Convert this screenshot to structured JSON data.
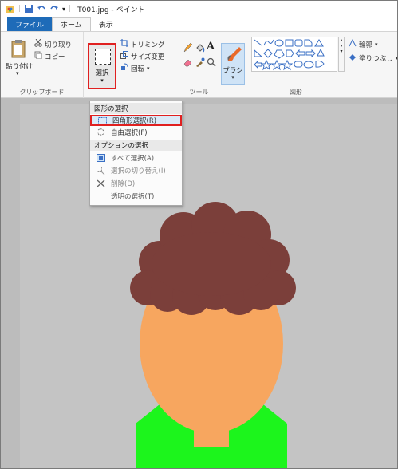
{
  "window": {
    "title": "T001.jpg - ペイント"
  },
  "tabs": {
    "file": "ファイル",
    "home": "ホーム",
    "view": "表示"
  },
  "ribbon": {
    "clipboard": {
      "paste": "貼り付け",
      "cut": "切り取り",
      "copy": "コピー",
      "label": "クリップボード"
    },
    "image": {
      "select": "選択",
      "crop": "トリミング",
      "resize": "サイズ変更",
      "rotate": "回転"
    },
    "tools": {
      "label": "ツール"
    },
    "brush": {
      "label": "ブラシ"
    },
    "shapes": {
      "label": "図形",
      "outline": "輪郭",
      "fill": "塗りつぶし"
    }
  },
  "select_menu": {
    "section_shape": "図形の選択",
    "rect_select": "四角形選択(R)",
    "free_select": "自由選択(F)",
    "section_options": "オプションの選択",
    "select_all": "すべて選択(A)",
    "invert_select": "選択の切り替え(I)",
    "delete": "削除(D)",
    "transparent": "透明の選択(T)"
  },
  "colors": {
    "accent": "#1e6bb8",
    "highlight_border": "#e02020",
    "hair": "#7b3f3a",
    "skin": "#f7a65f",
    "shirt": "#1cf51c",
    "canvas": "#c4c4c4"
  },
  "icons": [
    "paste-icon",
    "cut-icon",
    "copy-icon",
    "select-icon",
    "crop-icon",
    "resize-icon",
    "rotate-icon",
    "pencil-icon",
    "fill-icon",
    "text-icon",
    "eraser-icon",
    "picker-icon",
    "magnifier-icon",
    "brush-icon",
    "shapes-icon",
    "rect-select-icon",
    "free-select-icon",
    "select-all-icon",
    "invert-icon",
    "delete-icon"
  ]
}
